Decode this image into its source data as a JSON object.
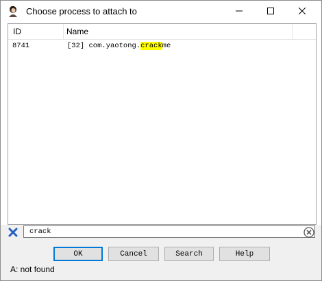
{
  "window": {
    "title": "Choose process to attach to"
  },
  "table": {
    "columns": [
      "ID",
      "Name"
    ],
    "rows": [
      {
        "id": "8741",
        "name_prefix": "[32] com.yaotong.",
        "name_match": "crack",
        "name_suffix": "me"
      }
    ]
  },
  "search": {
    "value": "crack"
  },
  "buttons": {
    "ok": "OK",
    "cancel": "Cancel",
    "search": "Search",
    "help": "Help"
  },
  "status": "A: not found",
  "colors": {
    "highlight": "#ffff00",
    "accent": "#0078d7",
    "clear_icon": "#2060c0"
  },
  "icons": {
    "app": "avatar-icon",
    "minimize": "minimize-icon",
    "maximize": "maximize-icon",
    "close": "close-icon",
    "clear": "clear-x-icon",
    "close_search": "circle-close-icon"
  }
}
